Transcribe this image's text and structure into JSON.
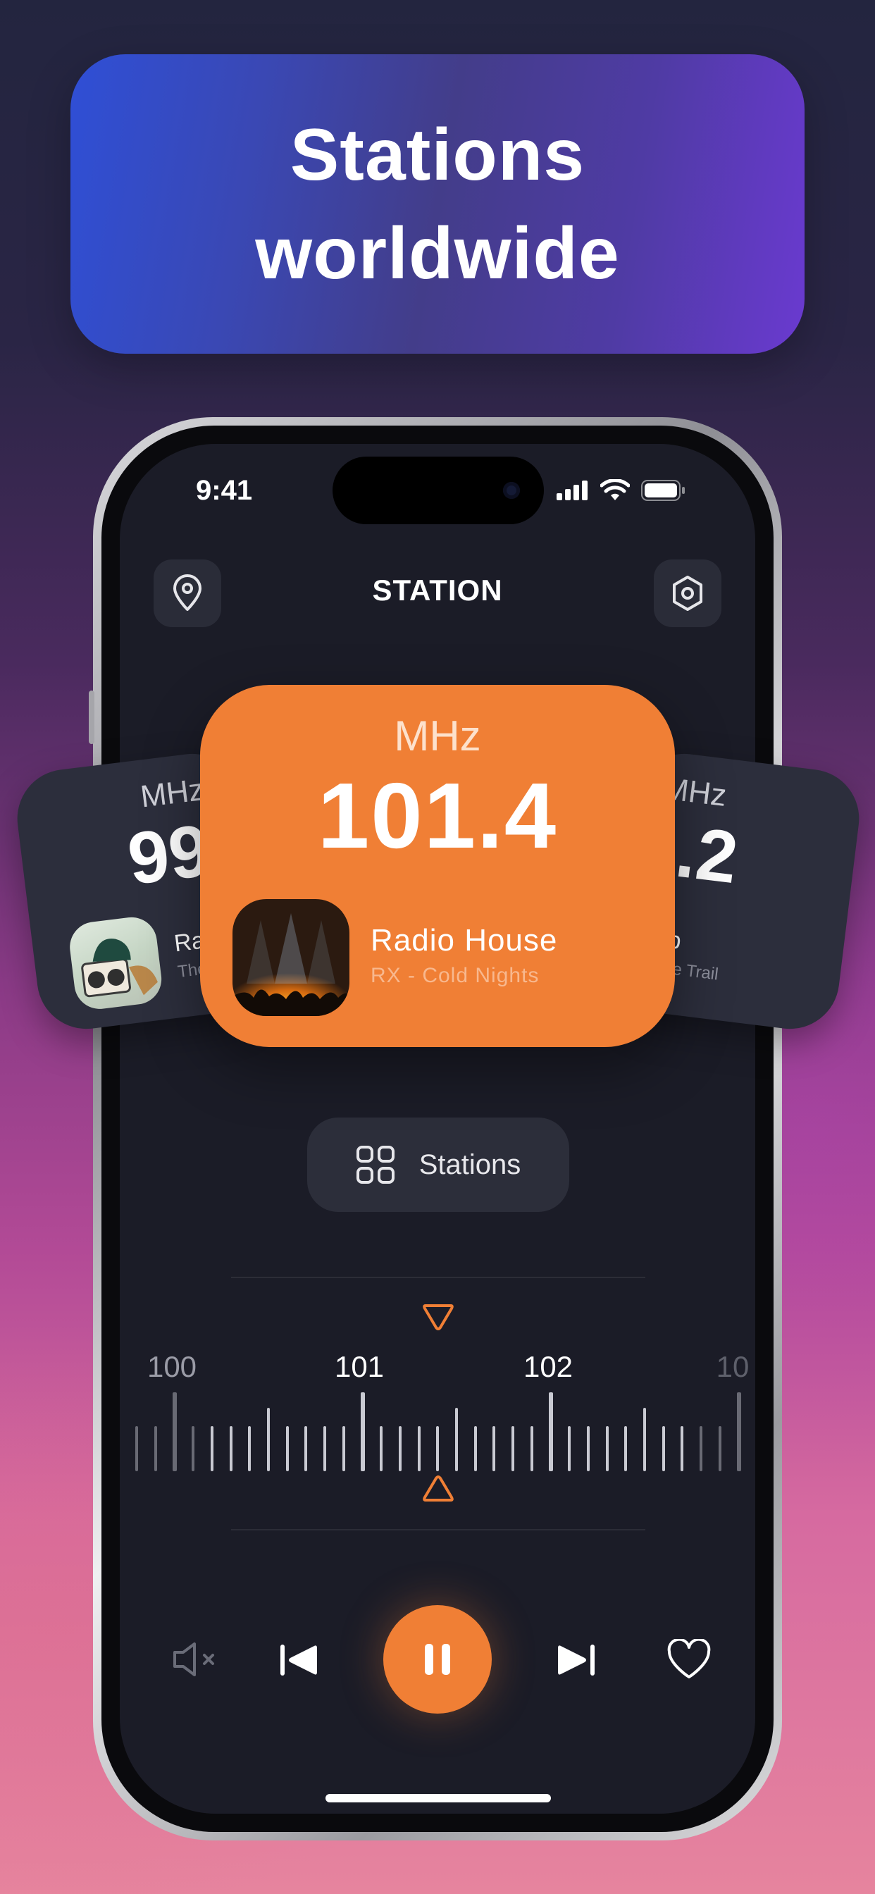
{
  "banner": {
    "title": "Stations worldwide"
  },
  "status_bar": {
    "time": "9:41"
  },
  "header": {
    "title": "STATION"
  },
  "cards": {
    "left": {
      "mhz": "MHz",
      "freq": "99",
      "name": "Ra",
      "track": "The"
    },
    "center": {
      "mhz": "MHz",
      "freq": "101.4",
      "name": "Radio House",
      "track": "RX - Cold Nights"
    },
    "right": {
      "mhz": "MHz",
      "freq": "3.2",
      "name": "op",
      "track": "of the Trail"
    }
  },
  "stations_button": {
    "label": "Stations"
  },
  "tuner": {
    "labels": [
      "100",
      "101",
      "102",
      "10"
    ],
    "current": 101.4
  },
  "controls": {
    "mute": "mute-icon",
    "previous": "previous-icon",
    "play_pause": "pause-icon",
    "next": "next-icon",
    "favorite": "heart-icon"
  },
  "colors": {
    "accent": "#f07f35",
    "screen_bg": "#1b1c27",
    "card_bg": "#2c2e3c"
  }
}
